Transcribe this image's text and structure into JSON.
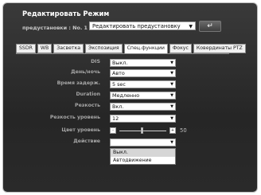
{
  "title": "Редактировать Режим",
  "preset": {
    "label": "предустановки : No. 1",
    "value": "Редактировать предустановку",
    "back_icon": "back-arrow-icon"
  },
  "tabs": [
    "SSDR",
    "WB",
    "Засветка",
    "Экспозиция",
    "Спец.функции",
    "Фокус",
    "Коорди­наты PTZ"
  ],
  "tabs_display": [
    "SSDR",
    "WB",
    "Засветка",
    "Экспозиция",
    "Спец.функции",
    "Фокус",
    "Ковердинаты PTZ"
  ],
  "active_tab": "Спец.функции",
  "fields": {
    "dis": {
      "label": "DIS",
      "value": "Выкл."
    },
    "day_night": {
      "label": "День/ночь",
      "value": "Авто"
    },
    "delay": {
      "label": "Время задерж.",
      "value": "5 sec"
    },
    "duration": {
      "label": "Duration",
      "value": "Медленно"
    },
    "sharpness": {
      "label": "Резкость",
      "value": "Вкл."
    },
    "sharpness_level": {
      "label": "Резкость уровень",
      "value": "12"
    },
    "color_level": {
      "label": "Цвет уровень",
      "minus": "-",
      "plus": "+",
      "value": "50",
      "level": 0.5
    },
    "action": {
      "label": "Действие",
      "value": "",
      "options": [
        "Выкл.",
        "Автодвижение"
      ],
      "highlighted": "Выкл."
    }
  }
}
